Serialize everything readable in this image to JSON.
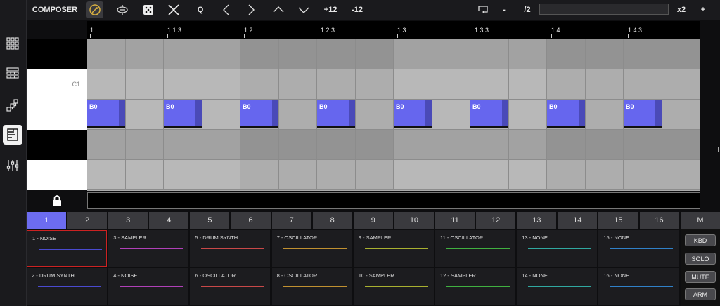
{
  "toolbar": {
    "title": "COMPOSER",
    "quantize_label": "Q",
    "transpose_up_label": "+12",
    "transpose_down_label": "-12",
    "minus_label": "-",
    "divide_label": "/2",
    "multiply_label": "x2",
    "plus_label": "+"
  },
  "ruler": {
    "ticks": [
      "1",
      "1.1.3",
      "1.2",
      "1.2.3",
      "1.3",
      "1.3.3",
      "1.4",
      "1.4.3"
    ]
  },
  "keys": {
    "c1_label": "C1"
  },
  "notes": [
    "B0",
    "B0",
    "B0",
    "B0",
    "B0",
    "B0",
    "B0",
    "B0"
  ],
  "tabs": [
    "1",
    "2",
    "3",
    "4",
    "5",
    "6",
    "7",
    "8",
    "9",
    "10",
    "11",
    "12",
    "13",
    "14",
    "15",
    "16"
  ],
  "mode_label": "M",
  "tracks": [
    {
      "name": "1 - NOISE",
      "color": "#4a4ad0"
    },
    {
      "name": "2 - DRUM SYNTH",
      "color": "#4a4ad0"
    },
    {
      "name": "3 - SAMPLER",
      "color": "#b040b8"
    },
    {
      "name": "4 - NOISE",
      "color": "#b040b8"
    },
    {
      "name": "5 - DRUM SYNTH",
      "color": "#c84848"
    },
    {
      "name": "6 - OSCILLATOR",
      "color": "#c84848"
    },
    {
      "name": "7 - OSCILLATOR",
      "color": "#c09030"
    },
    {
      "name": "8 - OSCILLATOR",
      "color": "#c09030"
    },
    {
      "name": "9 - SAMPLER",
      "color": "#a8b030"
    },
    {
      "name": "10 - SAMPLER",
      "color": "#a8b030"
    },
    {
      "name": "11 - OSCILLATOR",
      "color": "#40b040"
    },
    {
      "name": "12 - SAMPLER",
      "color": "#40b040"
    },
    {
      "name": "13 - NONE",
      "color": "#30a8a0"
    },
    {
      "name": "14 - NONE",
      "color": "#30a8a0"
    },
    {
      "name": "15 - NONE",
      "color": "#3080c8"
    },
    {
      "name": "16 - NONE",
      "color": "#3080c8"
    }
  ],
  "side_buttons": {
    "kbd": "KBD",
    "solo": "SOLO",
    "mute": "MUTE",
    "arm": "ARM"
  }
}
